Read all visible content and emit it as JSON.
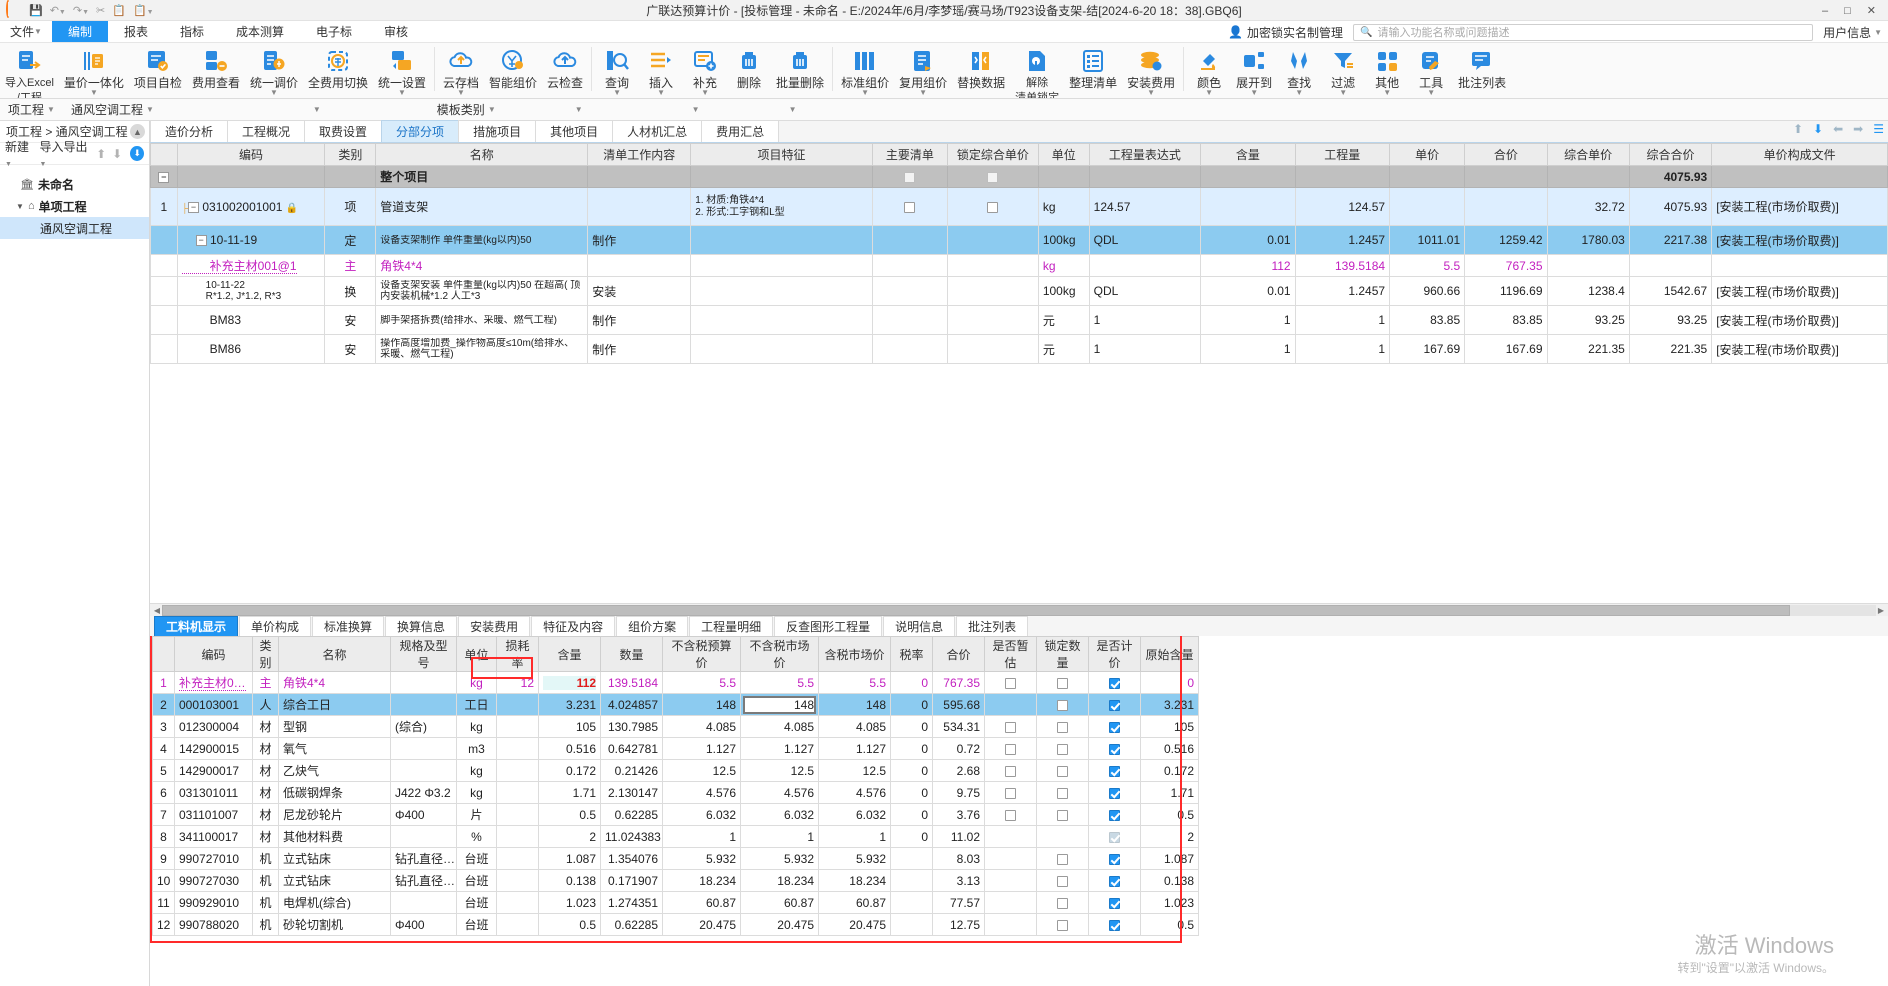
{
  "titlebar": {
    "app_title": "广联达预算计价 - [投标管理 - 未命名 - E:/2024年/6月/李梦瑶/赛马场/T923设备支架-结[2024-6-20 18：38].GBQ6]",
    "quick_access": [
      "save-icon",
      "undo-icon",
      "redo-icon",
      "cut-icon",
      "copy-icon",
      "paste-icon"
    ],
    "window_buttons": [
      "minimize",
      "maximize",
      "close"
    ]
  },
  "menubar": {
    "file_label": "文件",
    "items": [
      "编制",
      "报表",
      "指标",
      "成本测算",
      "电子标",
      "审核"
    ],
    "active": "编制",
    "lock_manager": "加密锁实名制管理",
    "search_placeholder": "请输入功能名称或问题描述",
    "user_label": "用户信息"
  },
  "ribbon": {
    "buttons": [
      {
        "label": "导入Excel",
        "icon": "import-excel-icon",
        "sub": "/工程",
        "caret": false
      },
      {
        "label": "量价一体化",
        "icon": "quantity-price-icon",
        "caret": true
      },
      {
        "label": "项目自检",
        "icon": "project-check-icon",
        "caret": false
      },
      {
        "label": "费用查看",
        "icon": "fee-view-icon",
        "caret": false
      },
      {
        "label": "统一调价",
        "icon": "unified-price-icon",
        "caret": true
      },
      {
        "label": "全费用切换",
        "icon": "full-fee-switch-icon",
        "caret": false
      },
      {
        "label": "统一设置",
        "icon": "unified-settings-icon",
        "caret": true
      },
      {
        "label": "云存档",
        "icon": "cloud-archive-icon",
        "caret": true
      },
      {
        "label": "智能组价",
        "icon": "smart-pricing-icon",
        "caret": false
      },
      {
        "label": "云检查",
        "icon": "cloud-check-icon",
        "caret": false
      },
      {
        "label": "查询",
        "icon": "query-icon",
        "caret": true
      },
      {
        "label": "插入",
        "icon": "insert-icon",
        "caret": true
      },
      {
        "label": "补充",
        "icon": "supplement-icon",
        "caret": true
      },
      {
        "label": "删除",
        "icon": "delete-icon",
        "caret": false
      },
      {
        "label": "批量删除",
        "icon": "batch-delete-icon",
        "caret": false
      },
      {
        "label": "标准组价",
        "icon": "standard-pricing-icon",
        "caret": true
      },
      {
        "label": "复用组价",
        "icon": "reuse-pricing-icon",
        "caret": true
      },
      {
        "label": "替换数据",
        "icon": "replace-data-icon",
        "caret": false
      },
      {
        "label": "解除",
        "icon": "unlock-icon",
        "sub": "清单锁定",
        "caret": false
      },
      {
        "label": "整理清单",
        "icon": "organize-list-icon",
        "caret": false
      },
      {
        "label": "安装费用",
        "icon": "install-fee-icon",
        "caret": true
      },
      {
        "label": "颜色",
        "icon": "color-icon",
        "caret": true
      },
      {
        "label": "展开到",
        "icon": "expand-to-icon",
        "caret": true
      },
      {
        "label": "查找",
        "icon": "find-icon",
        "caret": true
      },
      {
        "label": "过滤",
        "icon": "filter-icon",
        "caret": true
      },
      {
        "label": "其他",
        "icon": "other-icon",
        "caret": true
      },
      {
        "label": "工具",
        "icon": "tools-icon",
        "caret": true
      },
      {
        "label": "批注列表",
        "icon": "annotation-list-icon",
        "caret": false
      }
    ]
  },
  "secondbar": {
    "cells": [
      "项工程",
      "通风空调工程",
      "",
      "模板类别",
      "",
      "",
      ""
    ]
  },
  "sidebar": {
    "breadcrumb": "项工程 > 通风空调工程",
    "collapse_icon": "chevron-up-icon",
    "tools": {
      "new": "新建",
      "import_export": "导入导出",
      "up": "up-arrow-icon",
      "down": "down-arrow-icon",
      "download": "download-icon"
    },
    "tree": [
      {
        "label": "未命名",
        "level": 1,
        "icon": "project-icon",
        "selected": false
      },
      {
        "label": "单项工程",
        "level": 2,
        "icon": "building-icon",
        "selected": false
      },
      {
        "label": "通风空调工程",
        "level": 3,
        "icon": "",
        "selected": true
      }
    ]
  },
  "main_tabs": {
    "items": [
      "造价分析",
      "工程概况",
      "取费设置",
      "分部分项",
      "措施项目",
      "其他项目",
      "人材机汇总",
      "费用汇总"
    ],
    "active": "分部分项",
    "nav_icons": [
      "up-arrow-icon",
      "down-arrow-icon",
      "left-arrow-icon",
      "right-arrow-icon",
      "column-settings-icon"
    ]
  },
  "top_grid": {
    "columns": [
      "",
      "编码",
      "类别",
      "名称",
      "清单工作内容",
      "项目特征",
      "主要清单",
      "锁定综合单价",
      "单位",
      "工程量表达式",
      "含量",
      "工程量",
      "单价",
      "合价",
      "综合单价",
      "综合合价",
      "单价构成文件"
    ],
    "total_row": {
      "name": "整个项目",
      "composite_total": "4075.93"
    },
    "rows": [
      {
        "idx": "1",
        "code": "031002001001",
        "locked": true,
        "category": "项",
        "name": "管道支架",
        "work_content": "",
        "features": "1. 材质:角铁4*4\n2. 形式:工字钢和L型",
        "main_list": "checkbox",
        "lock_price": "checkbox",
        "unit": "kg",
        "expr": "124.57",
        "content": "",
        "quantity": "124.57",
        "price": "",
        "total": "",
        "composite_price": "32.72",
        "composite_total": "4075.93",
        "price_file": "[安装工程(市场价取费)]",
        "style": "lvl1"
      },
      {
        "idx": "",
        "code": "10-11-19",
        "locked": false,
        "category": "定",
        "name": "设备支架制作 单件重量(kg以内)50",
        "work_content": "制作",
        "features": "",
        "main_list": "",
        "lock_price": "",
        "unit": "100kg",
        "expr": "QDL",
        "content": "0.01",
        "quantity": "1.2457",
        "price": "1011.01",
        "total": "1259.42",
        "composite_price": "1780.03",
        "composite_total": "2217.38",
        "price_file": "[安装工程(市场价取费)]",
        "style": "sel-row"
      },
      {
        "idx": "",
        "code": "补充主材001@1",
        "locked": false,
        "category": "主",
        "name": "角铁4*4",
        "work_content": "",
        "features": "",
        "main_list": "",
        "lock_price": "",
        "unit": "kg",
        "expr": "",
        "content": "112",
        "quantity": "139.5184",
        "price": "5.5",
        "total": "767.35",
        "composite_price": "",
        "composite_total": "",
        "price_file": "",
        "style": "mag-row"
      },
      {
        "idx": "",
        "code": "10-11-22\nR*1.2, J*1.2, R*3",
        "locked": false,
        "category": "换",
        "name": "设备支架安装 单件重量(kg以内)50  在超高( 顶内安装机械*1.2 人工*3",
        "work_content": "安装",
        "features": "",
        "main_list": "",
        "lock_price": "",
        "unit": "100kg",
        "expr": "QDL",
        "content": "0.01",
        "quantity": "1.2457",
        "price": "960.66",
        "total": "1196.69",
        "composite_price": "1238.4",
        "composite_total": "1542.67",
        "price_file": "[安装工程(市场价取费)]",
        "style": "white-row"
      },
      {
        "idx": "",
        "code": "BM83",
        "locked": false,
        "category": "安",
        "name": "脚手架搭拆费(给排水、采暖、燃气工程)",
        "work_content": "制作",
        "features": "",
        "main_list": "",
        "lock_price": "",
        "unit": "元",
        "expr": "1",
        "content": "1",
        "quantity": "1",
        "price": "83.85",
        "total": "83.85",
        "composite_price": "93.25",
        "composite_total": "93.25",
        "price_file": "[安装工程(市场价取费)]",
        "style": "white-row"
      },
      {
        "idx": "",
        "code": "BM86",
        "locked": false,
        "category": "安",
        "name": "操作高度增加费_操作物高度≤10m(给排水、采暖、燃气工程)",
        "work_content": "制作",
        "features": "",
        "main_list": "",
        "lock_price": "",
        "unit": "元",
        "expr": "1",
        "content": "1",
        "quantity": "1",
        "price": "167.69",
        "total": "167.69",
        "composite_price": "221.35",
        "composite_total": "221.35",
        "price_file": "[安装工程(市场价取费)]",
        "style": "white-row"
      }
    ]
  },
  "bottom_tabs": {
    "items": [
      "工料机显示",
      "单价构成",
      "标准换算",
      "换算信息",
      "安装费用",
      "特征及内容",
      "组价方案",
      "工程量明细",
      "反查图形工程量",
      "说明信息",
      "批注列表"
    ],
    "active": "工料机显示"
  },
  "bottom_grid": {
    "columns": [
      "",
      "编码",
      "类别",
      "名称",
      "规格及型号",
      "单位",
      "损耗率",
      "含量",
      "数量",
      "不含税预算价",
      "不含税市场价",
      "含税市场价",
      "税率",
      "合价",
      "是否暂估",
      "锁定数量",
      "是否计价",
      "原始含量"
    ],
    "highlight_column": "不含税市场价",
    "rows": [
      {
        "idx": "1",
        "code": "补充主材0…",
        "category": "主",
        "name": "角铁4*4",
        "spec": "",
        "unit": "kg",
        "loss": "12",
        "content": "112",
        "qty": "139.5184",
        "budget": "5.5",
        "market": "5.5",
        "tax_market": "5.5",
        "tax_rate": "0",
        "total": "767.35",
        "provisional": "checkbox",
        "lock_qty": "checkbox",
        "priced": "checked",
        "orig": "0",
        "style": "magenta"
      },
      {
        "idx": "2",
        "code": "000103001",
        "category": "人",
        "name": "综合工日",
        "spec": "",
        "unit": "工日",
        "loss": "",
        "content": "3.231",
        "qty": "4.024857",
        "budget": "148",
        "market": "148",
        "tax_market": "148",
        "tax_rate": "0",
        "total": "595.68",
        "provisional": "",
        "lock_qty": "checkbox",
        "priced": "checked",
        "orig": "3.231",
        "style": "selected"
      },
      {
        "idx": "3",
        "code": "012300004",
        "category": "材",
        "name": "型钢",
        "spec": "(综合)",
        "unit": "kg",
        "loss": "",
        "content": "105",
        "qty": "130.7985",
        "budget": "4.085",
        "market": "4.085",
        "tax_market": "4.085",
        "tax_rate": "0",
        "total": "534.31",
        "provisional": "checkbox",
        "lock_qty": "checkbox",
        "priced": "checked",
        "orig": "105",
        "style": ""
      },
      {
        "idx": "4",
        "code": "142900015",
        "category": "材",
        "name": "氧气",
        "spec": "",
        "unit": "m3",
        "loss": "",
        "content": "0.516",
        "qty": "0.642781",
        "budget": "1.127",
        "market": "1.127",
        "tax_market": "1.127",
        "tax_rate": "0",
        "total": "0.72",
        "provisional": "checkbox",
        "lock_qty": "checkbox",
        "priced": "checked",
        "orig": "0.516",
        "style": ""
      },
      {
        "idx": "5",
        "code": "142900017",
        "category": "材",
        "name": "乙炔气",
        "spec": "",
        "unit": "kg",
        "loss": "",
        "content": "0.172",
        "qty": "0.21426",
        "budget": "12.5",
        "market": "12.5",
        "tax_market": "12.5",
        "tax_rate": "0",
        "total": "2.68",
        "provisional": "checkbox",
        "lock_qty": "checkbox",
        "priced": "checked",
        "orig": "0.172",
        "style": ""
      },
      {
        "idx": "6",
        "code": "031301011",
        "category": "材",
        "name": "低碳钢焊条",
        "spec": "J422 Φ3.2",
        "unit": "kg",
        "loss": "",
        "content": "1.71",
        "qty": "2.130147",
        "budget": "4.576",
        "market": "4.576",
        "tax_market": "4.576",
        "tax_rate": "0",
        "total": "9.75",
        "provisional": "checkbox",
        "lock_qty": "checkbox",
        "priced": "checked",
        "orig": "1.71",
        "style": ""
      },
      {
        "idx": "7",
        "code": "031101007",
        "category": "材",
        "name": "尼龙砂轮片",
        "spec": "Φ400",
        "unit": "片",
        "loss": "",
        "content": "0.5",
        "qty": "0.62285",
        "budget": "6.032",
        "market": "6.032",
        "tax_market": "6.032",
        "tax_rate": "0",
        "total": "3.76",
        "provisional": "checkbox",
        "lock_qty": "checkbox",
        "priced": "checked",
        "orig": "0.5",
        "style": ""
      },
      {
        "idx": "8",
        "code": "341100017",
        "category": "材",
        "name": "其他材料费",
        "spec": "",
        "unit": "%",
        "loss": "",
        "content": "2",
        "qty": "11.024383",
        "budget": "1",
        "market": "1",
        "tax_market": "1",
        "tax_rate": "0",
        "total": "11.02",
        "provisional": "",
        "lock_qty": "",
        "priced": "checked-disabled",
        "orig": "2",
        "style": ""
      },
      {
        "idx": "9",
        "code": "990727010",
        "category": "机",
        "name": "立式钻床",
        "spec": "钻孔直径…",
        "unit": "台班",
        "loss": "",
        "content": "1.087",
        "qty": "1.354076",
        "budget": "5.932",
        "market": "5.932",
        "tax_market": "5.932",
        "tax_rate": "",
        "total": "8.03",
        "provisional": "",
        "lock_qty": "checkbox",
        "priced": "checked",
        "orig": "1.087",
        "style": ""
      },
      {
        "idx": "10",
        "code": "990727030",
        "category": "机",
        "name": "立式钻床",
        "spec": "钻孔直径…",
        "unit": "台班",
        "loss": "",
        "content": "0.138",
        "qty": "0.171907",
        "budget": "18.234",
        "market": "18.234",
        "tax_market": "18.234",
        "tax_rate": "",
        "total": "3.13",
        "provisional": "",
        "lock_qty": "checkbox",
        "priced": "checked",
        "orig": "0.138",
        "style": ""
      },
      {
        "idx": "11",
        "code": "990929010",
        "category": "机",
        "name": "电焊机(综合)",
        "spec": "",
        "unit": "台班",
        "loss": "",
        "content": "1.023",
        "qty": "1.274351",
        "budget": "60.87",
        "market": "60.87",
        "tax_market": "60.87",
        "tax_rate": "",
        "total": "77.57",
        "provisional": "",
        "lock_qty": "checkbox",
        "priced": "checked",
        "orig": "1.023",
        "style": ""
      },
      {
        "idx": "12",
        "code": "990788020",
        "category": "机",
        "name": "砂轮切割机",
        "spec": "Φ400",
        "unit": "台班",
        "loss": "",
        "content": "0.5",
        "qty": "0.62285",
        "budget": "20.475",
        "market": "20.475",
        "tax_market": "20.475",
        "tax_rate": "",
        "total": "12.75",
        "provisional": "",
        "lock_qty": "checkbox",
        "priced": "checked",
        "orig": "0.5",
        "style": ""
      }
    ]
  },
  "watermark": {
    "line1": "激活 Windows",
    "line2": "转到\"设置\"以激活 Windows。"
  },
  "colors": {
    "accent": "#2196f3",
    "highlight": "#fde2c4",
    "magenta": "#c21fbf",
    "red_box": "#ff2a2a",
    "selected_row": "#8ccbf0"
  }
}
